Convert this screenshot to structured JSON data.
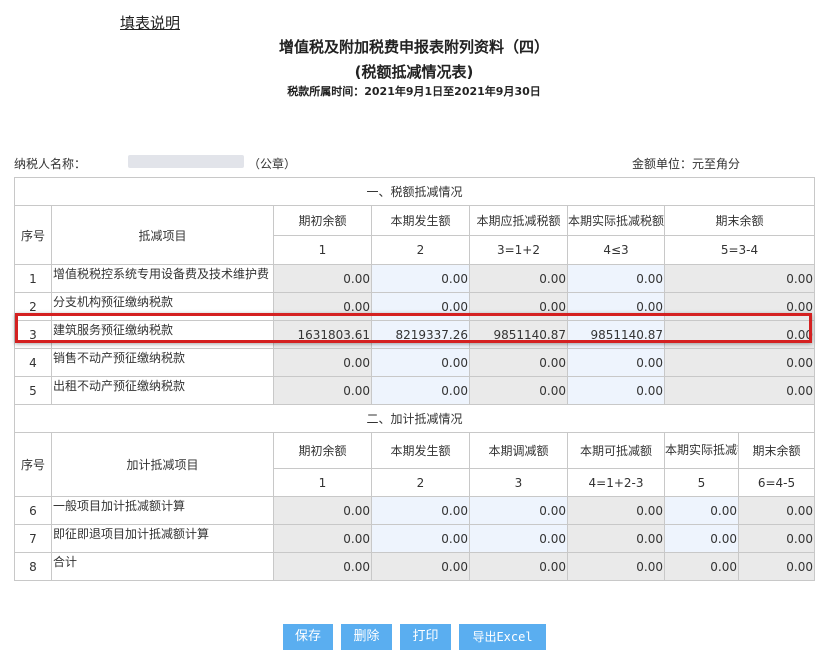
{
  "header": {
    "help_link": "填表说明",
    "title": "增值税及附加税费申报表附列资料（四）",
    "subtitle": "(税额抵减情况表)",
    "period": "税款所属时间：2021年9月1日至2021年9月30日"
  },
  "meta": {
    "taxpayer_label": "纳税人名称：",
    "seal": "（公章）",
    "unit": "金额单位：元至角分"
  },
  "section1": {
    "title": "一、税额抵减情况",
    "headers": {
      "seq": "序号",
      "item": "抵减项目",
      "c1": "期初余额",
      "c2": "本期发生额",
      "c3": "本期应抵减税额",
      "c4": "本期实际抵减税额",
      "c5": "期末余额"
    },
    "col_nums": [
      "1",
      "2",
      "3=1+2",
      "4≤3",
      "5=3-4"
    ],
    "rows": [
      {
        "seq": "1",
        "name": "增值税税控系统专用设备费及技术维护费",
        "c1": "0.00",
        "c2": "0.00",
        "c3": "0.00",
        "c4": "0.00",
        "c5": "0.00"
      },
      {
        "seq": "2",
        "name": "分支机构预征缴纳税款",
        "c1": "0.00",
        "c2": "0.00",
        "c3": "0.00",
        "c4": "0.00",
        "c5": "0.00"
      },
      {
        "seq": "3",
        "name": "建筑服务预征缴纳税款",
        "c1": "1631803.61",
        "c2": "8219337.26",
        "c3": "9851140.87",
        "c4": "9851140.87",
        "c5": "0.00"
      },
      {
        "seq": "4",
        "name": "销售不动产预征缴纳税款",
        "c1": "0.00",
        "c2": "0.00",
        "c3": "0.00",
        "c4": "0.00",
        "c5": "0.00"
      },
      {
        "seq": "5",
        "name": "出租不动产预征缴纳税款",
        "c1": "0.00",
        "c2": "0.00",
        "c3": "0.00",
        "c4": "0.00",
        "c5": "0.00"
      }
    ]
  },
  "section2": {
    "title": "二、加计抵减情况",
    "headers": {
      "seq": "序号",
      "item": "加计抵减项目",
      "c1": "期初余额",
      "c2": "本期发生额",
      "c3": "本期调减额",
      "c4": "本期可抵减额",
      "c5": "本期实际抵减额",
      "c6": "期末余额"
    },
    "col_nums": [
      "1",
      "2",
      "3",
      "4=1+2-3",
      "5",
      "6=4-5"
    ],
    "rows": [
      {
        "seq": "6",
        "name": "一般项目加计抵减额计算",
        "c1": "0.00",
        "c2": "0.00",
        "c3": "0.00",
        "c4": "0.00",
        "c5": "0.00",
        "c6": "0.00"
      },
      {
        "seq": "7",
        "name": "即征即退项目加计抵减额计算",
        "c1": "0.00",
        "c2": "0.00",
        "c3": "0.00",
        "c4": "0.00",
        "c5": "0.00",
        "c6": "0.00"
      },
      {
        "seq": "8",
        "name": "合计",
        "c1": "0.00",
        "c2": "0.00",
        "c3": "0.00",
        "c4": "0.00",
        "c5": "0.00",
        "c6": "0.00"
      }
    ]
  },
  "buttons": {
    "save": "保存",
    "delete": "删除",
    "print": "打印",
    "export": "导出Excel"
  }
}
